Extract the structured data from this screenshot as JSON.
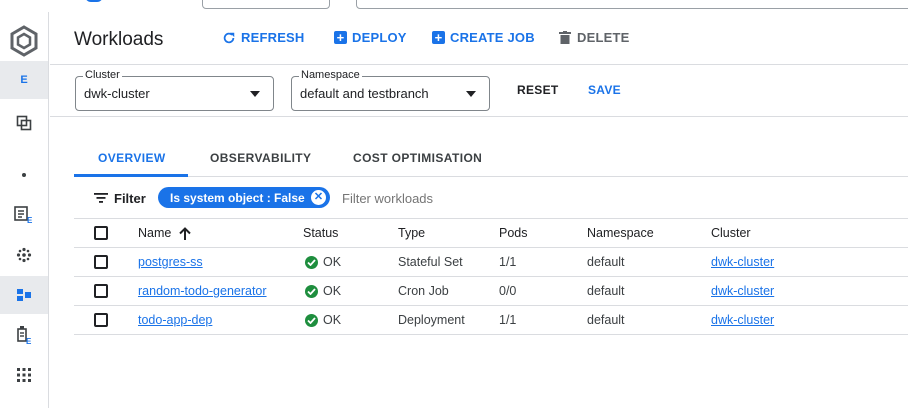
{
  "header": {
    "title": "Workloads",
    "refresh_label": "REFRESH",
    "deploy_label": "DEPLOY",
    "create_job_label": "CREATE JOB",
    "delete_label": "DELETE"
  },
  "rail": {
    "active_letter": "E"
  },
  "filters": {
    "cluster": {
      "label": "Cluster",
      "value": "dwk-cluster"
    },
    "namespace": {
      "label": "Namespace",
      "value": "default and testbranch"
    },
    "reset_label": "RESET",
    "save_label": "SAVE"
  },
  "tabs": [
    {
      "label": "OVERVIEW",
      "active": true
    },
    {
      "label": "OBSERVABILITY",
      "active": false
    },
    {
      "label": "COST OPTIMISATION",
      "active": false
    }
  ],
  "filterbar": {
    "label": "Filter",
    "chip": "Is system object : False",
    "placeholder": "Filter workloads"
  },
  "table": {
    "columns": [
      "Name",
      "Status",
      "Type",
      "Pods",
      "Namespace",
      "Cluster"
    ],
    "rows": [
      {
        "name": "postgres-ss",
        "status": "OK",
        "type": "Stateful Set",
        "pods": "1/1",
        "namespace": "default",
        "cluster": "dwk-cluster"
      },
      {
        "name": "random-todo-generator",
        "status": "OK",
        "type": "Cron Job",
        "pods": "0/0",
        "namespace": "default",
        "cluster": "dwk-cluster"
      },
      {
        "name": "todo-app-dep",
        "status": "OK",
        "type": "Deployment",
        "pods": "1/1",
        "namespace": "default",
        "cluster": "dwk-cluster"
      }
    ]
  },
  "colors": {
    "accent": "#1a73e8",
    "ok": "#1e8e3e",
    "text": "#202124",
    "muted": "#5f6368"
  }
}
